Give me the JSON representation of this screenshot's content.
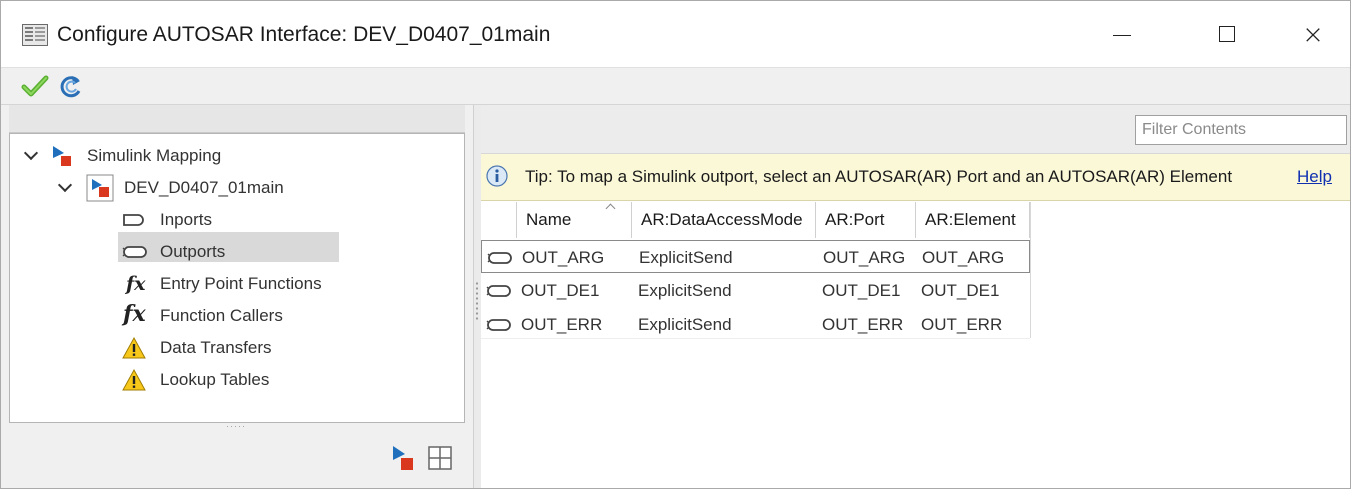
{
  "window": {
    "title": "Configure AUTOSAR Interface: DEV_D0407_01main",
    "controls": {
      "minimize": "minimize",
      "maximize": "maximize",
      "close": "×"
    }
  },
  "toolbar": {
    "icons": [
      "apply-checkmark-icon",
      "refresh-icon"
    ],
    "colors": {
      "check": "#5bb033",
      "refresh": "#2a6fb5"
    }
  },
  "tree": {
    "root": {
      "label": "Simulink Mapping",
      "icon": "simulink-mapping-icon"
    },
    "model": {
      "label": "DEV_D0407_01main",
      "icon": "model-icon"
    },
    "items": [
      {
        "label": "Inports",
        "icon": "inport-icon"
      },
      {
        "label": "Outports",
        "icon": "outport-icon",
        "selected": true
      },
      {
        "label": "Entry Point Functions",
        "icon": "fx-icon"
      },
      {
        "label": "Function Callers",
        "icon": "fx-caller-icon"
      },
      {
        "label": "Data Transfers",
        "icon": "warning-icon"
      },
      {
        "label": "Lookup Tables",
        "icon": "warning-icon"
      }
    ]
  },
  "right": {
    "filter": {
      "placeholder": "Filter Contents",
      "value": ""
    },
    "tip": {
      "text": "Tip: To map a Simulink outport, select an AUTOSAR(AR) Port and an AUTOSAR(AR) Element",
      "help": "Help",
      "bg": "#fbf8d8"
    },
    "table": {
      "columns": [
        "Name",
        "AR:DataAccessMode",
        "AR:Port",
        "AR:Element"
      ],
      "sort_column": "Name",
      "rows": [
        {
          "name": "OUT_ARG",
          "mode": "ExplicitSend",
          "port": "OUT_ARG",
          "element": "OUT_ARG",
          "selected": true
        },
        {
          "name": "OUT_DE1",
          "mode": "ExplicitSend",
          "port": "OUT_DE1",
          "element": "OUT_DE1"
        },
        {
          "name": "OUT_ERR",
          "mode": "ExplicitSend",
          "port": "OUT_ERR",
          "element": "OUT_ERR"
        }
      ]
    }
  }
}
